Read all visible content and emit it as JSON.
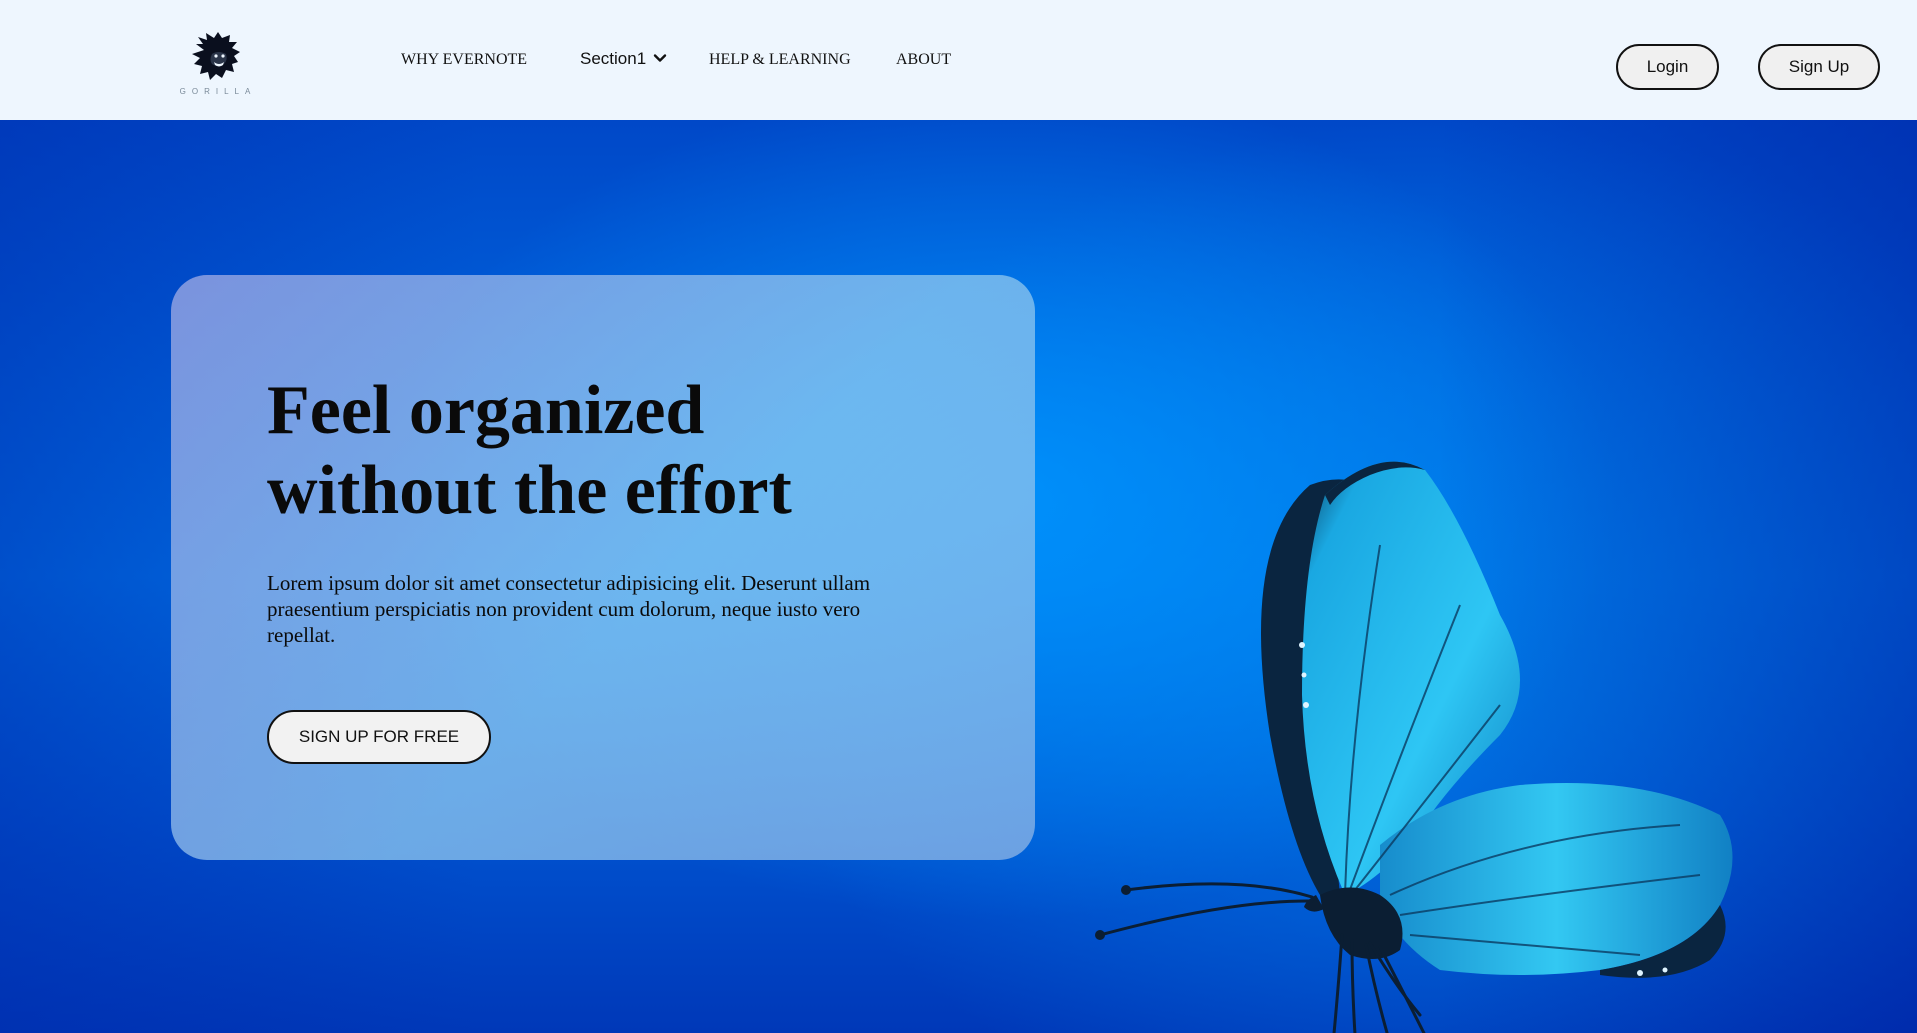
{
  "nav": {
    "logo_text": "GORILLA",
    "links": [
      {
        "label": "WHY EVERNOTE"
      },
      {
        "label": "Section1"
      },
      {
        "label": "HELP & LEARNING"
      },
      {
        "label": "ABOUT"
      }
    ],
    "login_label": "Login",
    "signup_label": "Sign Up"
  },
  "hero": {
    "headline": "Feel organized without the effort",
    "body": "Lorem ipsum dolor sit amet consectetur adipisicing elit. Deserunt ullam praesentium perspiciatis non provident cum dolorum, neque iusto vero repellat.",
    "cta_label": "SIGN UP FOR FREE"
  },
  "colors": {
    "nav_background": "#eef6fe",
    "hero_blue": "#0062dc",
    "card_glass": "#96c4ec",
    "butterfly_wing": "#22b8f0"
  },
  "icons": {
    "logo": "gorilla-logo-icon",
    "dropdown": "chevron-down-icon",
    "hero_image": "butterfly-illustration"
  }
}
